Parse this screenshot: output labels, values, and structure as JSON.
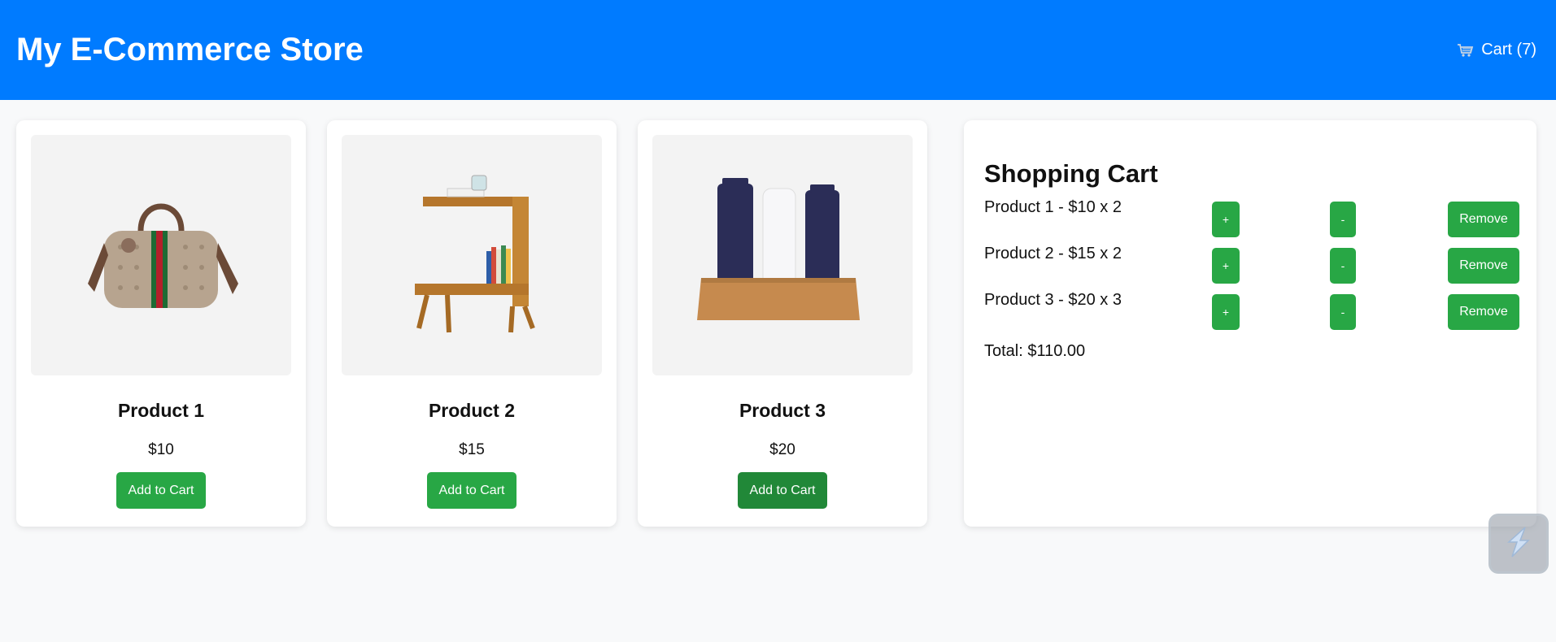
{
  "header": {
    "title": "My E-Commerce Store",
    "cart_icon": "shopping-cart-icon",
    "cart_label": "Cart (7)",
    "background": "#007bff"
  },
  "products": [
    {
      "name": "Product 1",
      "price": "$10",
      "button": "Add to Cart",
      "image": "duffle-bag"
    },
    {
      "name": "Product 2",
      "price": "$15",
      "button": "Add to Cart",
      "image": "wooden-side-table"
    },
    {
      "name": "Product 3",
      "price": "$20",
      "button": "Add to Cart",
      "image": "skincare-tubes"
    }
  ],
  "cart": {
    "title": "Shopping Cart",
    "items": [
      {
        "text": "Product 1 - $10 x 2",
        "plus": "+",
        "minus": "-",
        "remove": "Remove"
      },
      {
        "text": "Product 2 - $15 x 2",
        "plus": "+",
        "minus": "-",
        "remove": "Remove"
      },
      {
        "text": "Product 3 - $20 x 3",
        "plus": "+",
        "minus": "-",
        "remove": "Remove"
      }
    ],
    "total": "Total: $110.00"
  },
  "colors": {
    "accent": "#007bff",
    "button": "#28a745",
    "button_hover": "#218838"
  },
  "floating_button_icon": "lightning-icon"
}
